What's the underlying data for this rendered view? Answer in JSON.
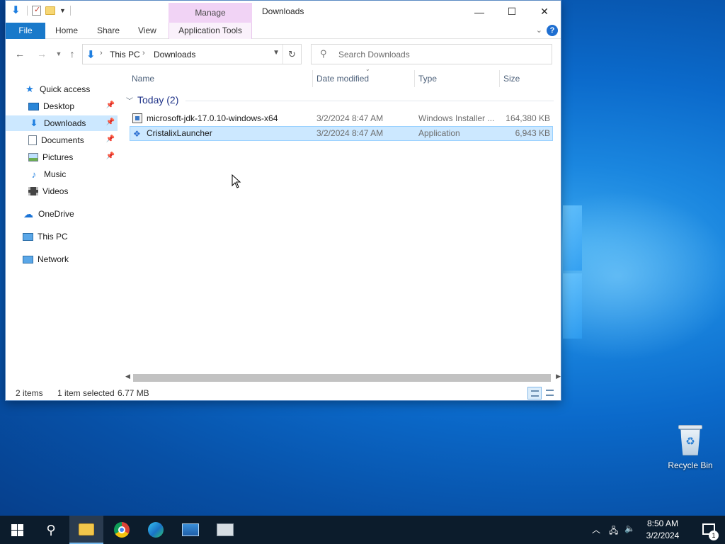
{
  "window": {
    "title": "Downloads",
    "manage_tab": "Manage"
  },
  "ribbon": {
    "file": "File",
    "home": "Home",
    "share": "Share",
    "view": "View",
    "app_tools": "Application Tools"
  },
  "address": {
    "crumbs": [
      "This PC",
      "Downloads"
    ]
  },
  "search": {
    "placeholder": "Search Downloads"
  },
  "nav": {
    "quick_access": "Quick access",
    "items": [
      {
        "label": "Desktop",
        "pinned": true
      },
      {
        "label": "Downloads",
        "pinned": true,
        "selected": true
      },
      {
        "label": "Documents",
        "pinned": true
      },
      {
        "label": "Pictures",
        "pinned": true
      },
      {
        "label": "Music",
        "pinned": false
      },
      {
        "label": "Videos",
        "pinned": false
      }
    ],
    "onedrive": "OneDrive",
    "this_pc": "This PC",
    "network": "Network"
  },
  "columns": {
    "name": "Name",
    "date": "Date modified",
    "type": "Type",
    "size": "Size"
  },
  "group": {
    "label": "Today (2)"
  },
  "files": [
    {
      "name": "microsoft-jdk-17.0.10-windows-x64",
      "date": "3/2/2024 8:47 AM",
      "type": "Windows Installer ...",
      "size": "164,380 KB"
    },
    {
      "name": "CristalixLauncher",
      "date": "3/2/2024 8:47 AM",
      "type": "Application",
      "size": "6,943 KB"
    }
  ],
  "status": {
    "count": "2 items",
    "selection": "1 item selected",
    "size": "6.77 MB"
  },
  "desktop": {
    "recycle_bin": "Recycle Bin"
  },
  "tray": {
    "time": "8:50 AM",
    "date": "3/2/2024",
    "notifications": "1"
  },
  "colors": {
    "accent": "#1979ca",
    "selection": "#cce8ff",
    "manage_tab": "#f1d3f5",
    "taskbar": "#0c1c2c"
  }
}
